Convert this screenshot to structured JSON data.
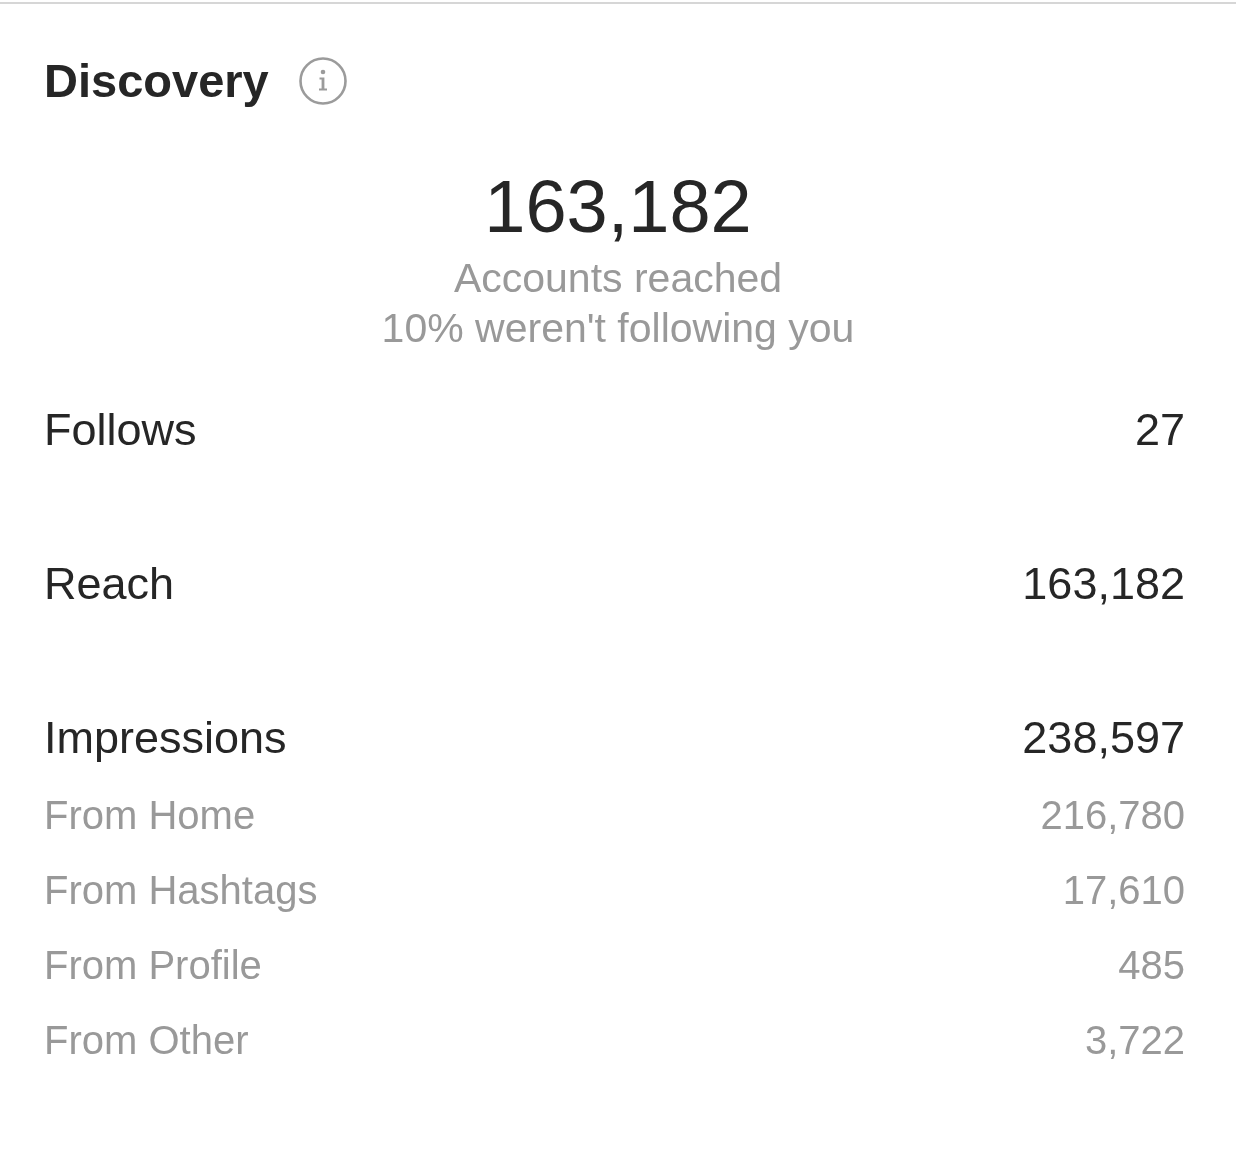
{
  "header": {
    "title": "Discovery"
  },
  "summary": {
    "value": "163,182",
    "label": "Accounts reached",
    "note": "10% weren't following you"
  },
  "metrics": [
    {
      "kind": "main",
      "label": "Follows",
      "value": "27"
    },
    {
      "kind": "main",
      "label": "Reach",
      "value": "163,182"
    },
    {
      "kind": "main",
      "label": "Impressions",
      "value": "238,597"
    },
    {
      "kind": "sub",
      "label": "From Home",
      "value": "216,780"
    },
    {
      "kind": "sub",
      "label": "From Hashtags",
      "value": "17,610"
    },
    {
      "kind": "sub",
      "label": "From Profile",
      "value": "485"
    },
    {
      "kind": "sub",
      "label": "From Other",
      "value": "3,722"
    }
  ]
}
